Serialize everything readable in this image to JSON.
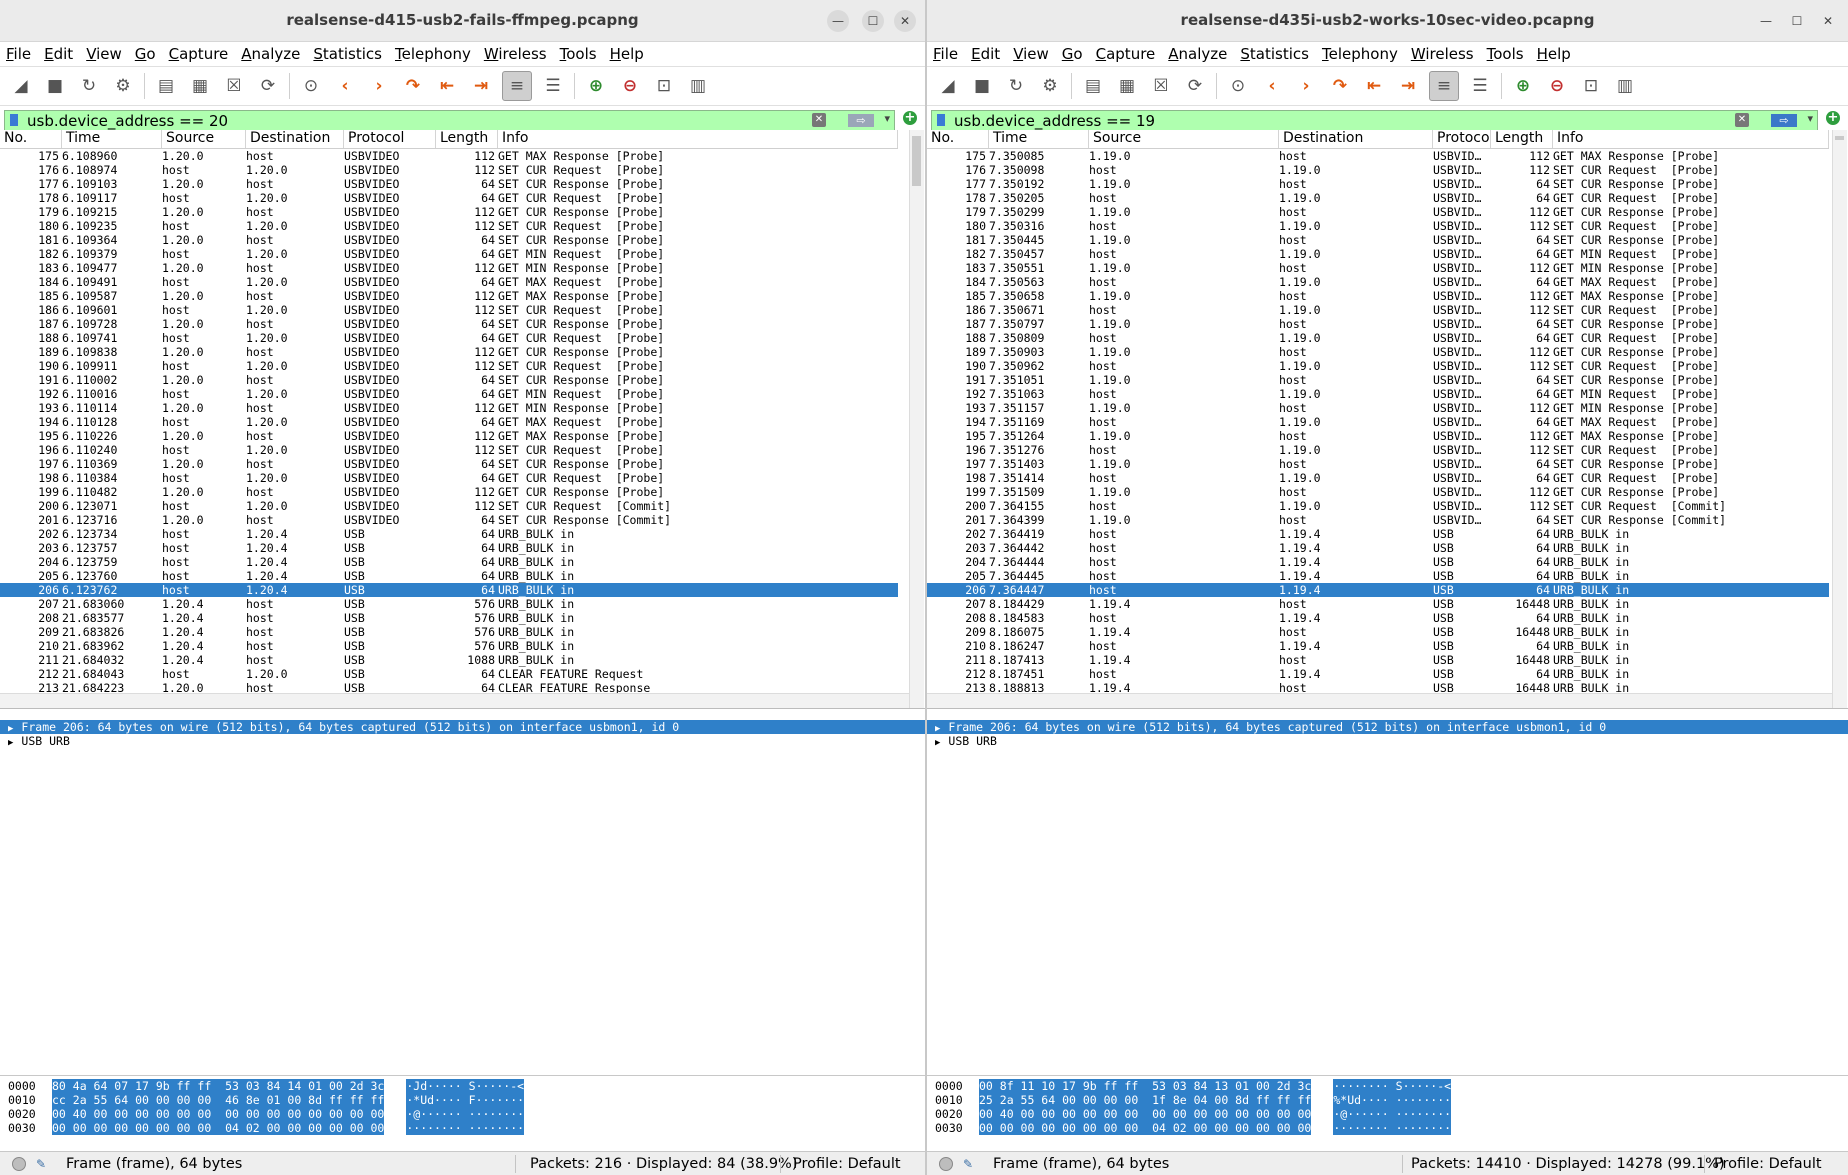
{
  "colors": {
    "selected_row": "#2f80c9",
    "filter_bg": "#afffaf",
    "titlebar": "#ebebeb"
  },
  "menu": [
    "File",
    "Edit",
    "View",
    "Go",
    "Capture",
    "Analyze",
    "Statistics",
    "Telephony",
    "Wireless",
    "Tools",
    "Help"
  ],
  "toolbar_icons": [
    "shark-fin-start-icon",
    "stop-icon",
    "restart-icon",
    "options-gear-icon",
    "open-folder-icon",
    "file-icon",
    "close-file-icon",
    "reload-icon",
    "find-icon",
    "back-arrow-icon",
    "forward-arrow-icon",
    "go-to-packet-icon",
    "first-packet-icon",
    "last-packet-icon",
    "autoscroll-icon",
    "colorize-icon",
    "zoom-in-icon",
    "zoom-out-icon",
    "normal-size-icon",
    "resize-columns-icon"
  ],
  "columns": [
    "No.",
    "Time",
    "Source",
    "Destination",
    "Protocol",
    "Length",
    "Info"
  ],
  "columns_right": [
    "No.",
    "Time",
    "Source",
    "Destination",
    "Protoco",
    "Length",
    "Info"
  ],
  "left": {
    "title": "realsense-d415-usb2-fails-ffmpeg.pcapng",
    "filter": "usb.device_address == 20",
    "selected_no": "206",
    "rows": [
      [
        "175",
        "6.108960",
        "1.20.0",
        "host",
        "USBVIDEO",
        "112",
        "GET MAX Response [Probe]"
      ],
      [
        "176",
        "6.108974",
        "host",
        "1.20.0",
        "USBVIDEO",
        "112",
        "SET CUR Request  [Probe]"
      ],
      [
        "177",
        "6.109103",
        "1.20.0",
        "host",
        "USBVIDEO",
        "64",
        "SET CUR Response [Probe]"
      ],
      [
        "178",
        "6.109117",
        "host",
        "1.20.0",
        "USBVIDEO",
        "64",
        "GET CUR Request  [Probe]"
      ],
      [
        "179",
        "6.109215",
        "1.20.0",
        "host",
        "USBVIDEO",
        "112",
        "GET CUR Response [Probe]"
      ],
      [
        "180",
        "6.109235",
        "host",
        "1.20.0",
        "USBVIDEO",
        "112",
        "SET CUR Request  [Probe]"
      ],
      [
        "181",
        "6.109364",
        "1.20.0",
        "host",
        "USBVIDEO",
        "64",
        "SET CUR Response [Probe]"
      ],
      [
        "182",
        "6.109379",
        "host",
        "1.20.0",
        "USBVIDEO",
        "64",
        "GET MIN Request  [Probe]"
      ],
      [
        "183",
        "6.109477",
        "1.20.0",
        "host",
        "USBVIDEO",
        "112",
        "GET MIN Response [Probe]"
      ],
      [
        "184",
        "6.109491",
        "host",
        "1.20.0",
        "USBVIDEO",
        "64",
        "GET MAX Request  [Probe]"
      ],
      [
        "185",
        "6.109587",
        "1.20.0",
        "host",
        "USBVIDEO",
        "112",
        "GET MAX Response [Probe]"
      ],
      [
        "186",
        "6.109601",
        "host",
        "1.20.0",
        "USBVIDEO",
        "112",
        "SET CUR Request  [Probe]"
      ],
      [
        "187",
        "6.109728",
        "1.20.0",
        "host",
        "USBVIDEO",
        "64",
        "SET CUR Response [Probe]"
      ],
      [
        "188",
        "6.109741",
        "host",
        "1.20.0",
        "USBVIDEO",
        "64",
        "GET CUR Request  [Probe]"
      ],
      [
        "189",
        "6.109838",
        "1.20.0",
        "host",
        "USBVIDEO",
        "112",
        "GET CUR Response [Probe]"
      ],
      [
        "190",
        "6.109911",
        "host",
        "1.20.0",
        "USBVIDEO",
        "112",
        "SET CUR Request  [Probe]"
      ],
      [
        "191",
        "6.110002",
        "1.20.0",
        "host",
        "USBVIDEO",
        "64",
        "SET CUR Response [Probe]"
      ],
      [
        "192",
        "6.110016",
        "host",
        "1.20.0",
        "USBVIDEO",
        "64",
        "GET MIN Request  [Probe]"
      ],
      [
        "193",
        "6.110114",
        "1.20.0",
        "host",
        "USBVIDEO",
        "112",
        "GET MIN Response [Probe]"
      ],
      [
        "194",
        "6.110128",
        "host",
        "1.20.0",
        "USBVIDEO",
        "64",
        "GET MAX Request  [Probe]"
      ],
      [
        "195",
        "6.110226",
        "1.20.0",
        "host",
        "USBVIDEO",
        "112",
        "GET MAX Response [Probe]"
      ],
      [
        "196",
        "6.110240",
        "host",
        "1.20.0",
        "USBVIDEO",
        "112",
        "SET CUR Request  [Probe]"
      ],
      [
        "197",
        "6.110369",
        "1.20.0",
        "host",
        "USBVIDEO",
        "64",
        "SET CUR Response [Probe]"
      ],
      [
        "198",
        "6.110384",
        "host",
        "1.20.0",
        "USBVIDEO",
        "64",
        "GET CUR Request  [Probe]"
      ],
      [
        "199",
        "6.110482",
        "1.20.0",
        "host",
        "USBVIDEO",
        "112",
        "GET CUR Response [Probe]"
      ],
      [
        "200",
        "6.123071",
        "host",
        "1.20.0",
        "USBVIDEO",
        "112",
        "SET CUR Request  [Commit]"
      ],
      [
        "201",
        "6.123716",
        "1.20.0",
        "host",
        "USBVIDEO",
        "64",
        "SET CUR Response [Commit]"
      ],
      [
        "202",
        "6.123734",
        "host",
        "1.20.4",
        "USB",
        "64",
        "URB_BULK in"
      ],
      [
        "203",
        "6.123757",
        "host",
        "1.20.4",
        "USB",
        "64",
        "URB_BULK in"
      ],
      [
        "204",
        "6.123759",
        "host",
        "1.20.4",
        "USB",
        "64",
        "URB_BULK in"
      ],
      [
        "205",
        "6.123760",
        "host",
        "1.20.4",
        "USB",
        "64",
        "URB_BULK in"
      ],
      [
        "206",
        "6.123762",
        "host",
        "1.20.4",
        "USB",
        "64",
        "URB_BULK in"
      ],
      [
        "207",
        "21.683060",
        "1.20.4",
        "host",
        "USB",
        "576",
        "URB_BULK in"
      ],
      [
        "208",
        "21.683577",
        "1.20.4",
        "host",
        "USB",
        "576",
        "URB_BULK in"
      ],
      [
        "209",
        "21.683826",
        "1.20.4",
        "host",
        "USB",
        "576",
        "URB_BULK in"
      ],
      [
        "210",
        "21.683962",
        "1.20.4",
        "host",
        "USB",
        "576",
        "URB_BULK in"
      ],
      [
        "211",
        "21.684032",
        "1.20.4",
        "host",
        "USB",
        "1088",
        "URB_BULK in"
      ],
      [
        "212",
        "21.684043",
        "host",
        "1.20.0",
        "USB",
        "64",
        "CLEAR FEATURE Request"
      ],
      [
        "213",
        "21.684223",
        "1.20.0",
        "host",
        "USB",
        "64",
        "CLEAR FEATURE Response"
      ]
    ],
    "detail": [
      "Frame 206: 64 bytes on wire (512 bits), 64 bytes captured (512 bits) on interface usbmon1, id 0",
      "USB URB"
    ],
    "bytes": [
      [
        "0000",
        "80 4a 64 07 17 9b ff ff  53 03 84 14 01 00 2d 3c",
        "·Jd····· S·····-<"
      ],
      [
        "0010",
        "cc 2a 55 64 00 00 00 00  46 8e 01 00 8d ff ff ff",
        "·*Ud···· F·······"
      ],
      [
        "0020",
        "00 40 00 00 00 00 00 00  00 00 00 00 00 00 00 00",
        "·@······ ········"
      ],
      [
        "0030",
        "00 00 00 00 00 00 00 00  04 02 00 00 00 00 00 00",
        "········ ········"
      ]
    ],
    "status": {
      "frame": "Frame (frame), 64 bytes",
      "packets": "Packets: 216 · Displayed: 84 (38.9%)",
      "profile": "Profile: Default"
    }
  },
  "right": {
    "title": "realsense-d435i-usb2-works-10sec-video.pcapng",
    "filter": "usb.device_address == 19",
    "selected_no": "206",
    "rows": [
      [
        "175",
        "7.350085",
        "1.19.0",
        "host",
        "USBVID…",
        "112",
        "GET MAX Response [Probe]"
      ],
      [
        "176",
        "7.350098",
        "host",
        "1.19.0",
        "USBVID…",
        "112",
        "SET CUR Request  [Probe]"
      ],
      [
        "177",
        "7.350192",
        "1.19.0",
        "host",
        "USBVID…",
        "64",
        "SET CUR Response [Probe]"
      ],
      [
        "178",
        "7.350205",
        "host",
        "1.19.0",
        "USBVID…",
        "64",
        "GET CUR Request  [Probe]"
      ],
      [
        "179",
        "7.350299",
        "1.19.0",
        "host",
        "USBVID…",
        "112",
        "GET CUR Response [Probe]"
      ],
      [
        "180",
        "7.350316",
        "host",
        "1.19.0",
        "USBVID…",
        "112",
        "SET CUR Request  [Probe]"
      ],
      [
        "181",
        "7.350445",
        "1.19.0",
        "host",
        "USBVID…",
        "64",
        "SET CUR Response [Probe]"
      ],
      [
        "182",
        "7.350457",
        "host",
        "1.19.0",
        "USBVID…",
        "64",
        "GET MIN Request  [Probe]"
      ],
      [
        "183",
        "7.350551",
        "1.19.0",
        "host",
        "USBVID…",
        "112",
        "GET MIN Response [Probe]"
      ],
      [
        "184",
        "7.350563",
        "host",
        "1.19.0",
        "USBVID…",
        "64",
        "GET MAX Request  [Probe]"
      ],
      [
        "185",
        "7.350658",
        "1.19.0",
        "host",
        "USBVID…",
        "112",
        "GET MAX Response [Probe]"
      ],
      [
        "186",
        "7.350671",
        "host",
        "1.19.0",
        "USBVID…",
        "112",
        "SET CUR Request  [Probe]"
      ],
      [
        "187",
        "7.350797",
        "1.19.0",
        "host",
        "USBVID…",
        "64",
        "SET CUR Response [Probe]"
      ],
      [
        "188",
        "7.350809",
        "host",
        "1.19.0",
        "USBVID…",
        "64",
        "GET CUR Request  [Probe]"
      ],
      [
        "189",
        "7.350903",
        "1.19.0",
        "host",
        "USBVID…",
        "112",
        "GET CUR Response [Probe]"
      ],
      [
        "190",
        "7.350962",
        "host",
        "1.19.0",
        "USBVID…",
        "112",
        "SET CUR Request  [Probe]"
      ],
      [
        "191",
        "7.351051",
        "1.19.0",
        "host",
        "USBVID…",
        "64",
        "SET CUR Response [Probe]"
      ],
      [
        "192",
        "7.351063",
        "host",
        "1.19.0",
        "USBVID…",
        "64",
        "GET MIN Request  [Probe]"
      ],
      [
        "193",
        "7.351157",
        "1.19.0",
        "host",
        "USBVID…",
        "112",
        "GET MIN Response [Probe]"
      ],
      [
        "194",
        "7.351169",
        "host",
        "1.19.0",
        "USBVID…",
        "64",
        "GET MAX Request  [Probe]"
      ],
      [
        "195",
        "7.351264",
        "1.19.0",
        "host",
        "USBVID…",
        "112",
        "GET MAX Response [Probe]"
      ],
      [
        "196",
        "7.351276",
        "host",
        "1.19.0",
        "USBVID…",
        "112",
        "SET CUR Request  [Probe]"
      ],
      [
        "197",
        "7.351403",
        "1.19.0",
        "host",
        "USBVID…",
        "64",
        "SET CUR Response [Probe]"
      ],
      [
        "198",
        "7.351414",
        "host",
        "1.19.0",
        "USBVID…",
        "64",
        "GET CUR Request  [Probe]"
      ],
      [
        "199",
        "7.351509",
        "1.19.0",
        "host",
        "USBVID…",
        "112",
        "GET CUR Response [Probe]"
      ],
      [
        "200",
        "7.364155",
        "host",
        "1.19.0",
        "USBVID…",
        "112",
        "SET CUR Request  [Commit]"
      ],
      [
        "201",
        "7.364399",
        "1.19.0",
        "host",
        "USBVID…",
        "64",
        "SET CUR Response [Commit]"
      ],
      [
        "202",
        "7.364419",
        "host",
        "1.19.4",
        "USB",
        "64",
        "URB_BULK in"
      ],
      [
        "203",
        "7.364442",
        "host",
        "1.19.4",
        "USB",
        "64",
        "URB_BULK in"
      ],
      [
        "204",
        "7.364444",
        "host",
        "1.19.4",
        "USB",
        "64",
        "URB_BULK in"
      ],
      [
        "205",
        "7.364445",
        "host",
        "1.19.4",
        "USB",
        "64",
        "URB_BULK in"
      ],
      [
        "206",
        "7.364447",
        "host",
        "1.19.4",
        "USB",
        "64",
        "URB_BULK in"
      ],
      [
        "207",
        "8.184429",
        "1.19.4",
        "host",
        "USB",
        "16448",
        "URB_BULK in"
      ],
      [
        "208",
        "8.184583",
        "host",
        "1.19.4",
        "USB",
        "64",
        "URB_BULK in"
      ],
      [
        "209",
        "8.186075",
        "1.19.4",
        "host",
        "USB",
        "16448",
        "URB_BULK in"
      ],
      [
        "210",
        "8.186247",
        "host",
        "1.19.4",
        "USB",
        "64",
        "URB_BULK in"
      ],
      [
        "211",
        "8.187413",
        "1.19.4",
        "host",
        "USB",
        "16448",
        "URB_BULK in"
      ],
      [
        "212",
        "8.187451",
        "host",
        "1.19.4",
        "USB",
        "64",
        "URB_BULK in"
      ],
      [
        "213",
        "8.188813",
        "1.19.4",
        "host",
        "USB",
        "16448",
        "URB_BULK in"
      ]
    ],
    "detail": [
      "Frame 206: 64 bytes on wire (512 bits), 64 bytes captured (512 bits) on interface usbmon1, id 0",
      "USB URB"
    ],
    "bytes": [
      [
        "0000",
        "00 8f 11 10 17 9b ff ff  53 03 84 13 01 00 2d 3c",
        "········ S·····-<"
      ],
      [
        "0010",
        "25 2a 55 64 00 00 00 00  1f 8e 04 00 8d ff ff ff",
        "%*Ud···· ········"
      ],
      [
        "0020",
        "00 40 00 00 00 00 00 00  00 00 00 00 00 00 00 00",
        "·@······ ········"
      ],
      [
        "0030",
        "00 00 00 00 00 00 00 00  04 02 00 00 00 00 00 00",
        "········ ········"
      ]
    ],
    "status": {
      "frame": "Frame (frame), 64 bytes",
      "packets": "Packets: 14410 · Displayed: 14278 (99.1%)",
      "profile": "Profile: Default"
    }
  }
}
